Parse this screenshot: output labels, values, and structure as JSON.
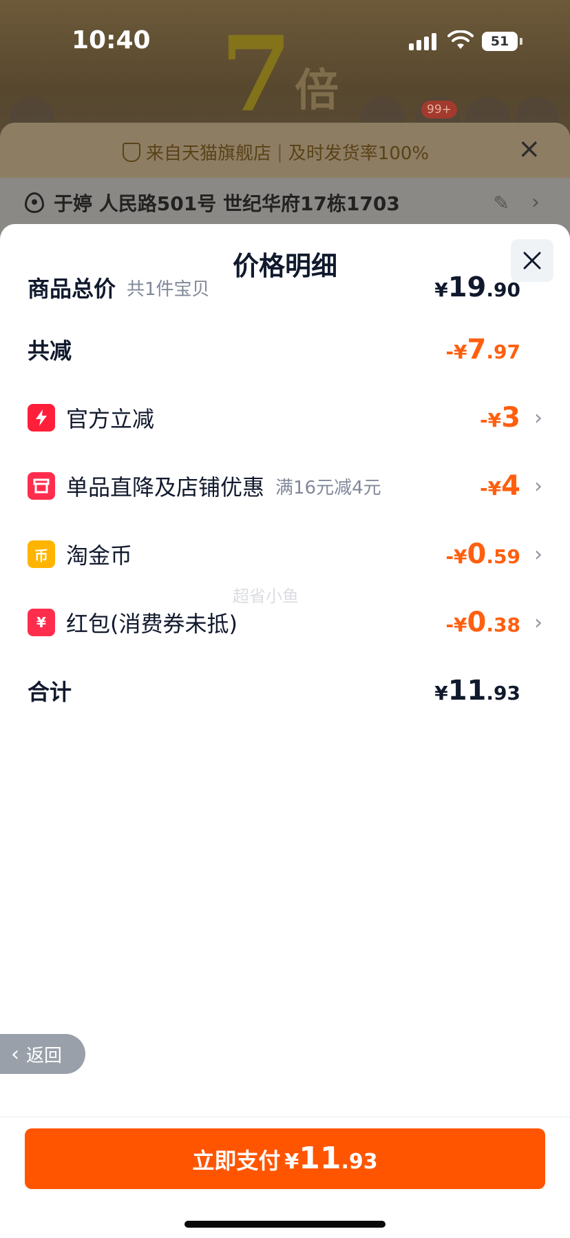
{
  "status_bar": {
    "time": "10:40",
    "battery": "51"
  },
  "background": {
    "promo_digit": "7",
    "promo_char": "倍",
    "cart_badge": "99+"
  },
  "store_bar": {
    "text_left": "来自天猫旗舰店",
    "divider": "|",
    "text_right": "及时发货率100%"
  },
  "address": {
    "text": "于婷 人民路501号 世纪华府17栋1703"
  },
  "sheet": {
    "title": "价格明细",
    "watermark": "超省小鱼"
  },
  "rows": {
    "total": {
      "label": "商品总价",
      "sub": "共1件宝贝",
      "currency": "¥",
      "int": "19",
      "dec": ".90"
    },
    "reduce": {
      "label": "共减",
      "currency": "-¥",
      "int": "7",
      "dec": ".97"
    },
    "official": {
      "label": "官方立减",
      "currency": "-¥",
      "int": "3",
      "dec": ""
    },
    "store": {
      "label": "单品直降及店铺优惠",
      "sub": "满16元减4元",
      "currency": "-¥",
      "int": "4",
      "dec": ""
    },
    "coin": {
      "label": "淘金币",
      "icon_char": "币",
      "currency": "-¥",
      "int": "0",
      "dec": ".59"
    },
    "redpack": {
      "label": "红包(消费券未抵)",
      "icon_char": "¥",
      "currency": "-¥",
      "int": "0",
      "dec": ".38"
    },
    "sum": {
      "label": "合计",
      "currency": "¥",
      "int": "11",
      "dec": ".93"
    }
  },
  "back_button": {
    "label": "返回"
  },
  "pay_button": {
    "label": "立即支付",
    "currency": "¥",
    "int": "11",
    "dec": ".93"
  },
  "colors": {
    "accent_orange": "#ff5500",
    "discount_orange": "#ff5f0f",
    "official_red": "#ff1f3a",
    "store_red": "#ff2d4d",
    "coin_yellow": "#ffb400",
    "redpack_red": "#ff2d4d"
  }
}
